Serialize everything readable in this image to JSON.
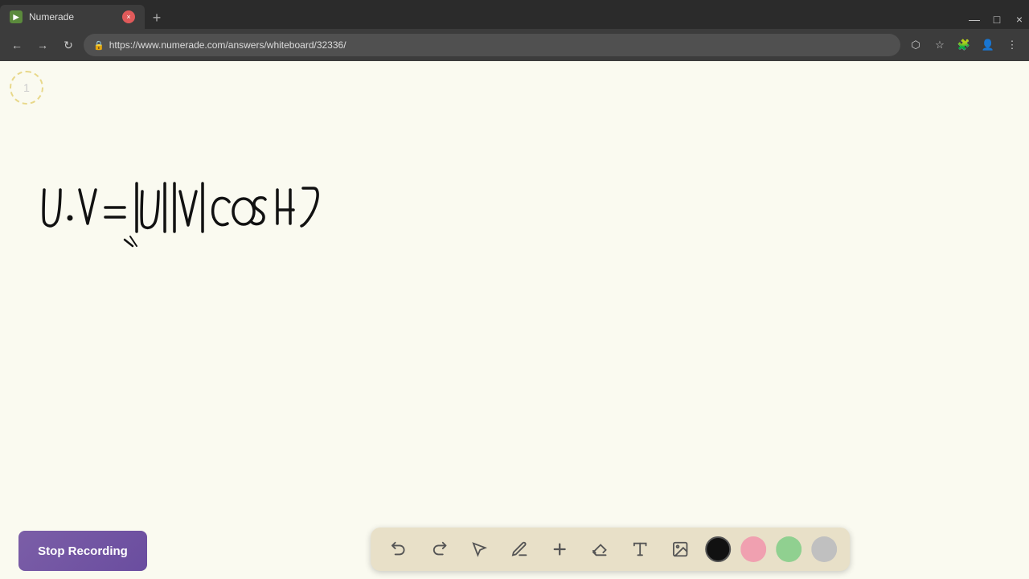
{
  "browser": {
    "tab_title": "Numerade",
    "url": "https://www.numerade.com/answers/whiteboard/32336/",
    "tab_close_label": "×",
    "tab_new_label": "+"
  },
  "nav": {
    "back_label": "←",
    "forward_label": "→",
    "reload_label": "↻"
  },
  "page": {
    "page_number": "1",
    "background_color": "#fafaf0"
  },
  "toolbar": {
    "undo_label": "↺",
    "redo_label": "↻",
    "select_label": "↖",
    "pen_label": "✏",
    "add_label": "+",
    "eraser_label": "/",
    "text_label": "A",
    "image_label": "🖼",
    "colors": [
      "#111111",
      "#f0a0b0",
      "#90d090",
      "#c0c0c0"
    ]
  },
  "recording": {
    "stop_button_label": "Stop Recording",
    "stop_button_color": "#7b5ea7"
  },
  "window_controls": {
    "minimize": "—",
    "maximize": "□",
    "close": "×"
  }
}
